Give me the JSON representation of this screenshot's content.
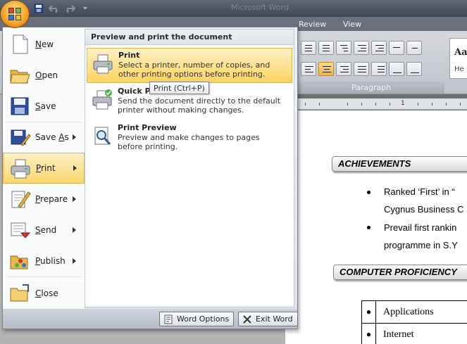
{
  "window": {
    "title": "Microsoft Word"
  },
  "ribbon": {
    "tabs": [
      "Review",
      "View"
    ],
    "paragraph_group_label": "Paragraph",
    "styles_preview_text": "Aa",
    "styles_preview_sub": "He"
  },
  "ruler": {
    "number": "1"
  },
  "office_menu": {
    "left_items": [
      {
        "label": "New",
        "icon": "new-document-icon",
        "has_arrow": false
      },
      {
        "label": "Open",
        "icon": "open-folder-icon",
        "has_arrow": false
      },
      {
        "label": "Save",
        "icon": "save-disk-icon",
        "has_arrow": false
      },
      {
        "label": "Save As",
        "icon": "save-as-icon",
        "has_arrow": true
      },
      {
        "label": "Print",
        "icon": "printer-icon",
        "has_arrow": true,
        "selected": true
      },
      {
        "label": "Prepare",
        "icon": "prepare-icon",
        "has_arrow": true
      },
      {
        "label": "Send",
        "icon": "send-icon",
        "has_arrow": true
      },
      {
        "label": "Publish",
        "icon": "publish-icon",
        "has_arrow": true
      },
      {
        "label": "Close",
        "icon": "close-folder-icon",
        "has_arrow": false
      }
    ],
    "right_title": "Preview and print the document",
    "options": [
      {
        "title": "Print",
        "desc": "Select a printer, number of copies, and other printing options before printing.",
        "icon": "printer-icon",
        "selected": true
      },
      {
        "title": "Quick Print",
        "desc": "Send the document directly to the default printer without making changes.",
        "icon": "quick-print-icon"
      },
      {
        "title": "Print Preview",
        "desc": "Preview and make changes to pages before printing.",
        "icon": "print-preview-icon"
      }
    ],
    "tooltip": "Print (Ctrl+P)",
    "word_options_label": "Word Options",
    "exit_word_label": "Exit Word"
  },
  "document": {
    "heading_achievements": "ACHIEVEMENTS",
    "bullet1_line1": "Ranked ‘First’ in “",
    "bullet1_line2": "Cygnus Business C",
    "bullet2_line1": "Prevail first rankin",
    "bullet2_line2": "programme in S.Y",
    "heading_computer": "COMPUTER PROFICIENCY",
    "table_rows": [
      "Applications",
      "Internet"
    ]
  }
}
